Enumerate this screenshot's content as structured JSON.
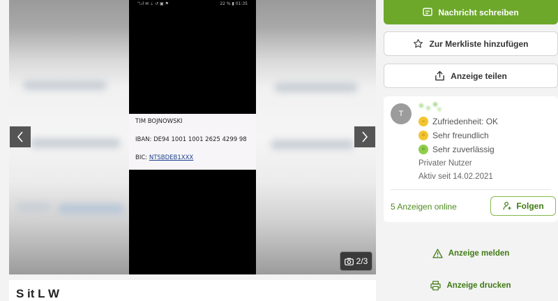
{
  "gallery": {
    "phone_status_left": "ℸ.ıl ✉ ⊥ ↺ ▣ ⚑",
    "phone_status_right": "22 % ▮ 01:35",
    "card": {
      "name": "TIM BOJNOWSKI",
      "iban": "IBAN: DE94 1001 1001 2625 4299 98",
      "bic_label": "BIC: ",
      "bic_value": "NTSBDEB1XXX"
    },
    "counter": "2/3"
  },
  "listing": {
    "title_partial": "S it L W"
  },
  "actions": {
    "message_button": "Nachricht schreiben",
    "watchlist_button": "Zur Merkliste hinzufügen",
    "share_button": "Anzeige teilen",
    "report_link": "Anzeige melden",
    "print_link": "Anzeige drucken"
  },
  "seller": {
    "avatar_initial": "T",
    "badges": [
      {
        "label": "Zufriedenheit: OK",
        "icon": "neutral-smiley-icon"
      },
      {
        "label": "Sehr freundlich",
        "icon": "friendly-smiley-icon"
      },
      {
        "label": "Sehr zuverlässig",
        "icon": "reliable-smiley-icon"
      }
    ],
    "user_type": "Privater Nutzer",
    "active_since": "Aktiv seit 14.02.2021",
    "ads_online": "5 Anzeigen online",
    "follow_button": "Folgen"
  },
  "colors": {
    "brand_green": "#6da82b",
    "link_green": "#3f7a14"
  }
}
